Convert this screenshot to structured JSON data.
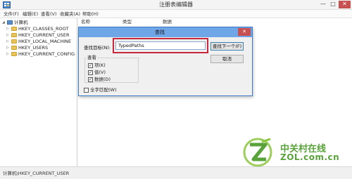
{
  "window": {
    "title": "注册表编辑器",
    "minimize": "—",
    "maximize": "□",
    "close": "✕"
  },
  "menu": {
    "file": "文件(F)",
    "edit": "编辑(E)",
    "view": "查看(V)",
    "favorites": "收藏夹(A)",
    "help": "帮助(H)"
  },
  "tree": {
    "root": "计算机",
    "items": [
      "HKEY_CLASSES_ROOT",
      "HKEY_CURRENT_USER",
      "HKEY_LOCAL_MACHINE",
      "HKEY_USERS",
      "HKEY_CURRENT_CONFIG"
    ]
  },
  "columns": {
    "name": "名称",
    "type": "类型",
    "data": "数据"
  },
  "status": {
    "path": "计算机\\HKEY_CURRENT_USER"
  },
  "dialog": {
    "title": "查找",
    "close": "✕",
    "find_label": "查找目标(N):",
    "find_value": "TypedPaths",
    "find_next": "查找下一个(F)",
    "cancel": "取消",
    "look_at_label": "查看",
    "options": [
      {
        "label": "项(K)",
        "checked": true
      },
      {
        "label": "值(V)",
        "checked": true
      },
      {
        "label": "数据(D)",
        "checked": true
      }
    ],
    "match_whole": {
      "label": "全字匹配(W)",
      "checked": false
    }
  },
  "watermark": {
    "brand_cn": "中关村在线",
    "brand_en": "ZOL.com.cn",
    "colors": {
      "green": "#5aa33a",
      "light_green": "#8cc63f"
    }
  },
  "colors": {
    "dialog_title": "#6fa6e8",
    "close_red": "#c75050",
    "highlight_red": "#c8283b"
  }
}
